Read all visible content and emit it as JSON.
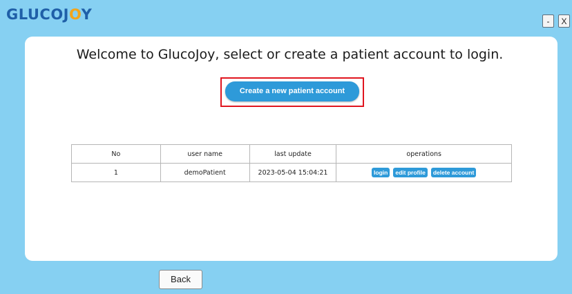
{
  "logo": {
    "part1": "GLUCOJ",
    "part2": "O",
    "part3": "Y"
  },
  "window": {
    "minimize": "-",
    "close": "X"
  },
  "welcome_text": "Welcome to GlucoJoy, select or create a patient account to login.",
  "create_button": "Create a new patient account",
  "table": {
    "headers": [
      "No",
      "user name",
      "last update",
      "operations"
    ],
    "rows": [
      {
        "no": "1",
        "user_name": "demoPatient",
        "last_update": "2023-05-04 15:04:21",
        "ops": [
          "login",
          "edit profile",
          "delete account"
        ]
      }
    ]
  },
  "back_button": "Back",
  "colors": {
    "background": "#86d0f2",
    "accent": "#2e9ad9",
    "highlight": "#e0141e",
    "logo_primary": "#1f5fa8",
    "logo_accent": "#f3a51b"
  }
}
